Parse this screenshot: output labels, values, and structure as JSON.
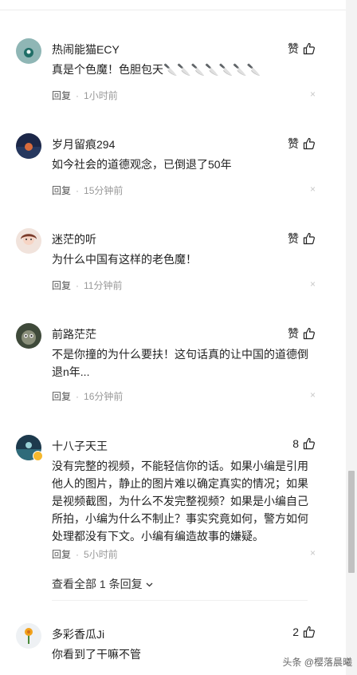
{
  "comments": [
    {
      "user": "热闹能猫ECY",
      "like": "赞",
      "text": "真是个色魔！色胆包天🔪🔪🔪🔪🔪🔪🔪",
      "reply": "回复",
      "sep": "·",
      "time": "1小时前",
      "close": "×"
    },
    {
      "user": "岁月留痕294",
      "like": "赞",
      "text": "如今社会的道德观念，已倒退了50年",
      "reply": "回复",
      "sep": "·",
      "time": "15分钟前",
      "close": "×"
    },
    {
      "user": "迷茫的听",
      "like": "赞",
      "text": "为什么中国有这样的老色魔！",
      "reply": "回复",
      "sep": "·",
      "time": "11分钟前",
      "close": "×"
    },
    {
      "user": "前路茫茫",
      "like": "赞",
      "text": "不是你撞的为什么要扶！这句话真的让中国的道德倒退n年...",
      "reply": "回复",
      "sep": "·",
      "time": "16分钟前",
      "close": "×"
    },
    {
      "user": "十八子天王",
      "like": "8",
      "text": "没有完整的视频，不能轻信你的话。如果小编是引用他人的图片，静止的图片难以确定真实的情况；如果是视频截图，为什么不发完整视频？如果是小编自己所拍，小编为什么不制止？事实究竟如何，警方如何处理都没有下文。小编有编造故事的嫌疑。",
      "reply": "回复",
      "sep": "·",
      "time": "5小时前",
      "close": "×"
    },
    {
      "user": "多彩香瓜Ji",
      "like": "2",
      "text": "你看到了干嘛不管",
      "reply": "",
      "sep": "",
      "time": "",
      "close": ""
    }
  ],
  "view_replies": "查看全部 1 条回复",
  "watermark": "头条 @樱落晨曦"
}
